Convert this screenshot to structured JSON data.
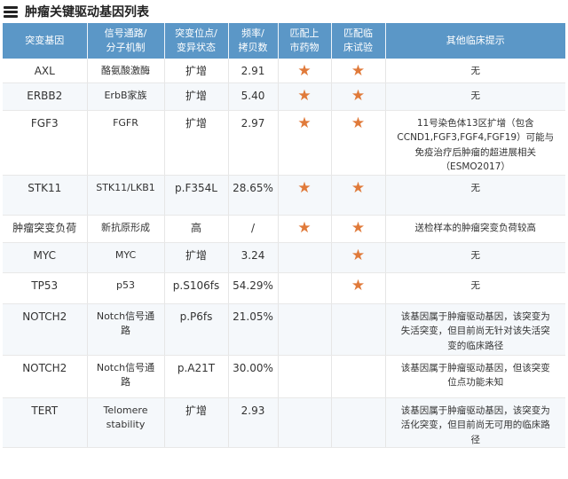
{
  "title": "肿瘤关键驱动基因列表",
  "colors": {
    "header_bg": "#5b97c7",
    "star": "#e07a3a"
  },
  "star_glyph": "★",
  "headers": [
    [
      "突变基因"
    ],
    [
      "信号通路/",
      "分子机制"
    ],
    [
      "突变位点/",
      "变异状态"
    ],
    [
      "频率/",
      "拷贝数"
    ],
    [
      "匹配上",
      "市药物"
    ],
    [
      "匹配临",
      "床试验"
    ],
    [
      "其他临床提示"
    ]
  ],
  "rows": [
    {
      "gene": "AXL",
      "pathway": [
        "酪氨酸激酶"
      ],
      "variant": "扩增",
      "freq": "2.91",
      "drug": true,
      "trial": true,
      "note": [
        "无"
      ]
    },
    {
      "gene": "ERBB2",
      "pathway": [
        "ErbB家族"
      ],
      "variant": "扩增",
      "freq": "5.40",
      "drug": true,
      "trial": true,
      "note": [
        "无"
      ]
    },
    {
      "gene": "FGF3",
      "pathway": [
        "FGFR"
      ],
      "variant": "扩增",
      "freq": "2.97",
      "drug": true,
      "trial": true,
      "note": [
        "11号染色体13区扩增（包含",
        "CCND1,FGF3,FGF4,FGF19）可能与",
        "免疫治疗后肿瘤的超进展相关",
        "（ESMO2017）"
      ]
    },
    {
      "gene": "STK11",
      "pathway": [
        "STK11/LKB1"
      ],
      "variant": "p.F354L",
      "freq": "28.65%",
      "drug": true,
      "trial": true,
      "note": [
        "无"
      ]
    },
    {
      "gene": "肿瘤突变负荷",
      "pathway": [
        "新抗原形成"
      ],
      "variant": "高",
      "freq": "/",
      "drug": true,
      "trial": true,
      "note": [
        "送检样本的肿瘤突变负荷较高"
      ]
    },
    {
      "gene": "MYC",
      "pathway": [
        "MYC"
      ],
      "variant": "扩增",
      "freq": "3.24",
      "drug": false,
      "trial": true,
      "note": [
        "无"
      ]
    },
    {
      "gene": "TP53",
      "pathway": [
        "p53"
      ],
      "variant": "p.S106fs",
      "freq": "54.29%",
      "drug": false,
      "trial": true,
      "note": [
        "无"
      ]
    },
    {
      "gene": "NOTCH2",
      "pathway": [
        "Notch信号通",
        "路"
      ],
      "variant": "p.P6fs",
      "freq": "21.05%",
      "drug": false,
      "trial": false,
      "note": [
        "该基因属于肿瘤驱动基因，该突变为",
        "失活突变，但目前尚无针对该失活突",
        "变的临床路径"
      ]
    },
    {
      "gene": "NOTCH2",
      "pathway": [
        "Notch信号通",
        "路"
      ],
      "variant": "p.A21T",
      "freq": "30.00%",
      "drug": false,
      "trial": false,
      "note": [
        "该基因属于肿瘤驱动基因，但该突变",
        "位点功能未知"
      ]
    },
    {
      "gene": "TERT",
      "pathway": [
        "Telomere",
        "stability"
      ],
      "variant": "扩增",
      "freq": "2.93",
      "drug": false,
      "trial": false,
      "note": [
        "该基因属于肿瘤驱动基因，该突变为",
        "活化突变，但目前尚无可用的临床路",
        "径"
      ]
    }
  ]
}
